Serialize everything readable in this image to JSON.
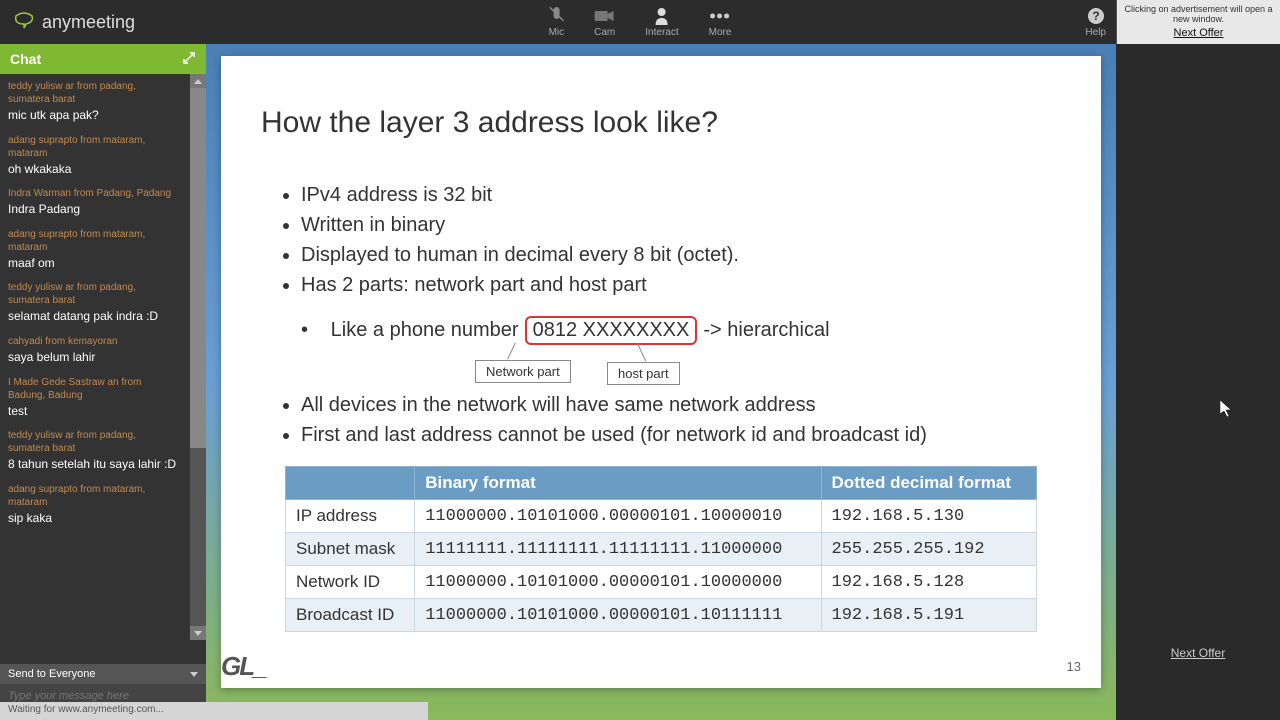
{
  "app": {
    "name": "anymeeting"
  },
  "topbar": {
    "mic": "Mic",
    "cam": "Cam",
    "interact": "Interact",
    "more": "More",
    "help": "Help"
  },
  "ad": {
    "notice": "Clicking on advertisement will open a new window.",
    "link": "Next Offer",
    "bottom_link": "Next Offer"
  },
  "chat": {
    "title": "Chat",
    "send_to": "Send to Everyone",
    "placeholder": "Type your message here",
    "messages": [
      {
        "from": "teddy yulisw ar from padang, sumatera barat",
        "text": "mic utk apa pak?"
      },
      {
        "from": "adang suprapto from mataram, mataram",
        "text": "oh wkakaka"
      },
      {
        "from": "Indra Warman from Padang, Padang",
        "text": "Indra Padang"
      },
      {
        "from": "adang suprapto from mataram, mataram",
        "text": "maaf om"
      },
      {
        "from": "teddy yulisw ar from padang, sumatera barat",
        "text": "selamat datang pak indra :D"
      },
      {
        "from": "cahyadi from kemayoran",
        "text": "saya belum lahir"
      },
      {
        "from": "I Made Gede Sastraw an from Badung, Badung",
        "text": "test"
      },
      {
        "from": "teddy yulisw ar from padang, sumatera barat",
        "text": "8 tahun setelah itu saya lahir :D"
      },
      {
        "from": "adang suprapto from mataram, mataram",
        "text": "sip kaka"
      }
    ]
  },
  "slide": {
    "title": "How the layer 3 address look like?",
    "bullets1": [
      "IPv4 address is 32 bit",
      "Written in binary",
      "Displayed to human in decimal every 8 bit (octet).",
      "Has 2 parts: network part and host part"
    ],
    "phone_prefix": "Like a phone number",
    "phone_highlight": "0812 XXXXXXXX",
    "phone_suffix": "-> hierarchical",
    "label_network": "Network part",
    "label_host": "host  part",
    "bullets2": [
      "All devices in the network will have same network address",
      "First and last address cannot be used (for network id and broadcast id)"
    ],
    "table": {
      "headers": [
        "",
        "Binary format",
        "Dotted decimal format"
      ],
      "rows": [
        [
          "IP address",
          "11000000.10101000.00000101.10000010",
          "192.168.5.130"
        ],
        [
          "Subnet mask",
          "11111111.11111111.11111111.11000000",
          "255.255.255.192"
        ],
        [
          "Network ID",
          "11000000.10101000.00000101.10000000",
          "192.168.5.128"
        ],
        [
          "Broadcast ID",
          "11000000.10101000.00000101.10111111",
          "192.168.5.191"
        ]
      ]
    },
    "page_number": "13",
    "logo_text": "GL_"
  },
  "status": "Waiting for www.anymeeting.com..."
}
